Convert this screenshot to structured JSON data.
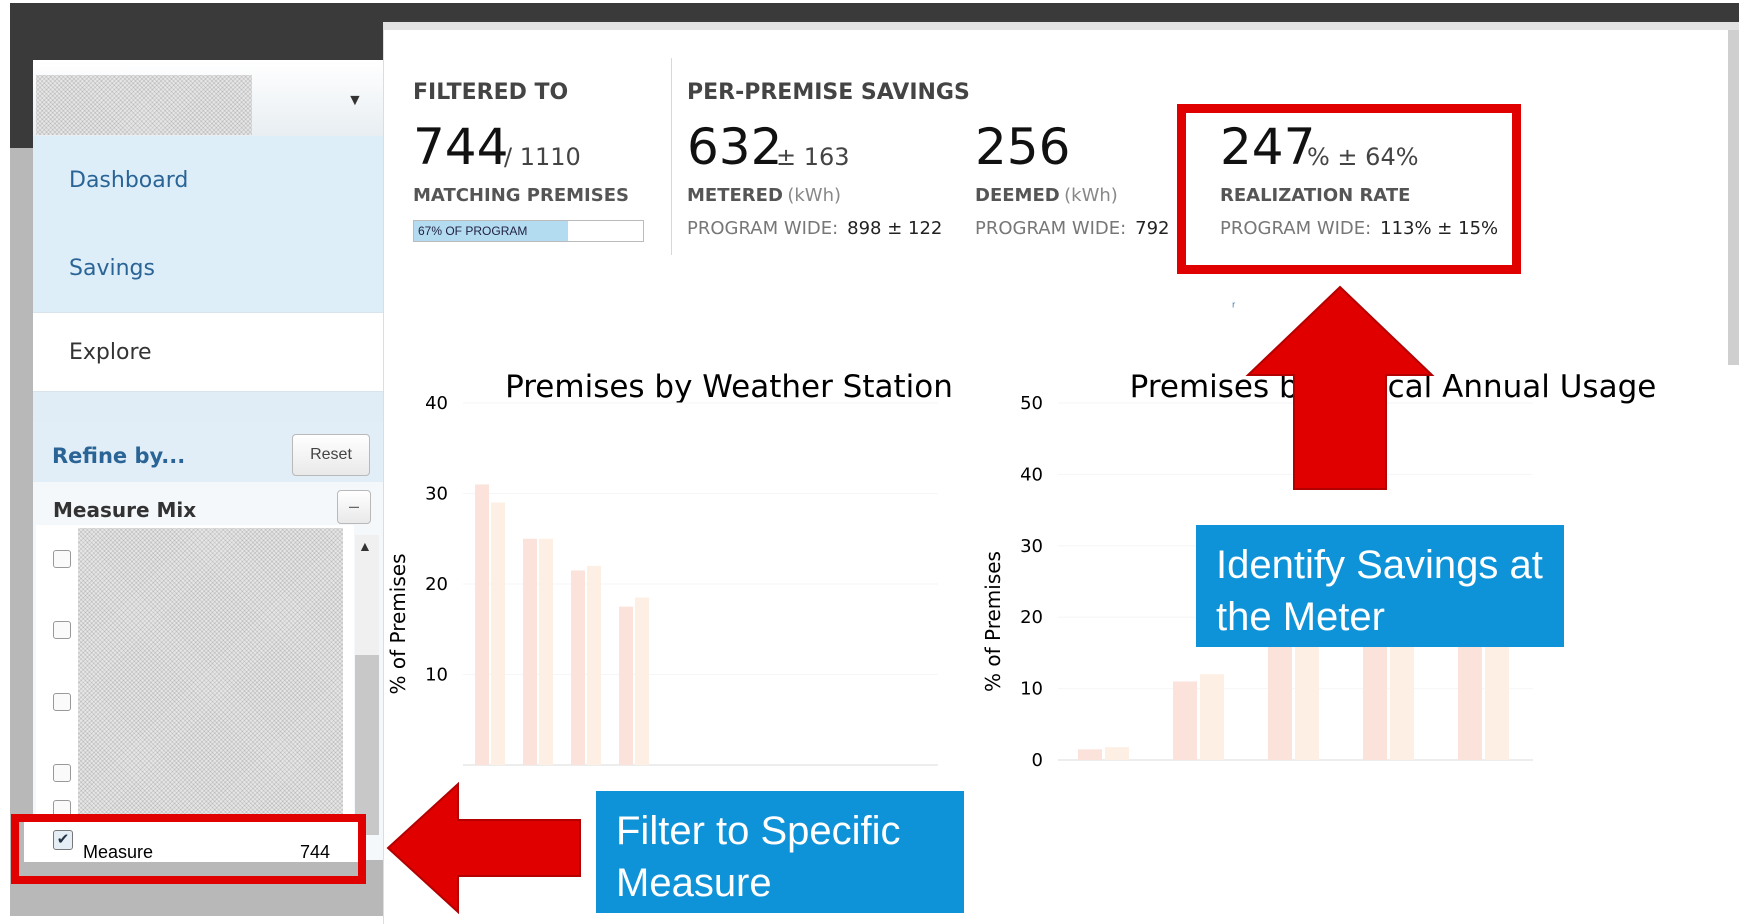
{
  "sidebar": {
    "nav": [
      {
        "label": "Dashboard"
      },
      {
        "label": "Savings"
      },
      {
        "label": "Explore"
      }
    ],
    "refine_label": "Refine by...",
    "reset_label": "Reset",
    "measure_mix_label": "Measure Mix",
    "collapse_symbol": "–",
    "selected_measure": {
      "label": "Measure",
      "count": "744",
      "checked": true
    }
  },
  "summary": {
    "filtered_to": {
      "heading": "FILTERED TO",
      "count": "744",
      "total": "/ 1110",
      "label": "MATCHING PREMISES",
      "progress_text": "67% OF PROGRAM",
      "progress_fraction": 0.67
    },
    "per_premise": {
      "heading": "PER-PREMISE SAVINGS",
      "metered": {
        "value": "632",
        "error": "± 163",
        "label": "METERED",
        "unit": "(kWh)",
        "program_wide_label": "PROGRAM WIDE:",
        "program_wide_value": "898 ± 122"
      },
      "deemed": {
        "value": "256",
        "label": "DEEMED",
        "unit": "(kWh)",
        "program_wide_label": "PROGRAM WIDE:",
        "program_wide_value": "792"
      },
      "realization_rate": {
        "value": "247",
        "error": "% ± 64%",
        "label": "REALIZATION RATE",
        "program_wide_label": "PROGRAM WIDE:",
        "program_wide_value": "113% ± 15%"
      }
    }
  },
  "charts": {
    "weather": {
      "title": "Premises by Weather Station"
    },
    "usage": {
      "title": "Premises by Typical Annual Usage"
    }
  },
  "chart_data": [
    {
      "type": "bar",
      "title": "Premises by Weather Station",
      "ylabel": "% of Premises",
      "ylim": [
        0,
        40
      ],
      "yticks": [
        40,
        30,
        20,
        10
      ],
      "series": [
        {
          "values": [
            31,
            25,
            21.5,
            17.5
          ]
        },
        {
          "values": [
            29,
            25,
            22,
            18.5
          ]
        }
      ]
    },
    {
      "type": "bar",
      "title": "Premises by Typical Annual Usage",
      "ylabel": "% of Premises",
      "ylim": [
        0,
        50
      ],
      "yticks": [
        50,
        40,
        30,
        20,
        10,
        0
      ],
      "series": [
        {
          "values": [
            1.5,
            11,
            22.5,
            25,
            24
          ]
        },
        {
          "values": [
            1.8,
            12,
            22.5,
            25,
            22.5
          ]
        }
      ]
    }
  ],
  "annotations": {
    "savings_callout": "Identify Savings at the Meter",
    "filter_callout": "Filter to Specific Measure"
  },
  "colors": {
    "highlight_red": "#e00000",
    "callout_blue": "#0f93d8",
    "nav_blue": "#2a6496"
  }
}
